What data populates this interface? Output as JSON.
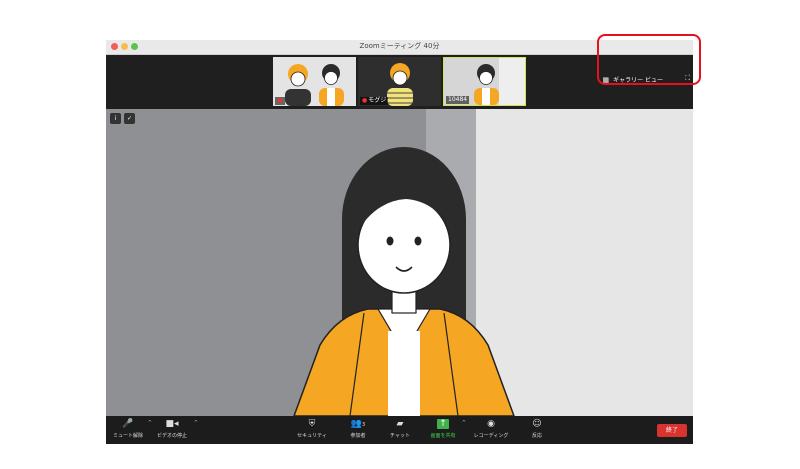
{
  "window": {
    "title": "Zoomミーティング   40分"
  },
  "thumbnails": [
    {
      "label": ""
    },
    {
      "label": "モグジ"
    },
    {
      "label": "10484"
    }
  ],
  "top_bar": {
    "gallery_view": "ギャラリー ビュー",
    "grid_icon": "grid-icon",
    "fullscreen_icon": "fullscreen-icon"
  },
  "toolbar": {
    "mute": "ミュート解除",
    "video": "ビデオの停止",
    "security": "セキュリティ",
    "participants": "参加者",
    "participants_count": "3",
    "chat": "チャット",
    "share": "画面を共有",
    "record": "レコーディング",
    "reactions": "反応",
    "end": "終了"
  },
  "colors": {
    "accent_green": "#3fd14a",
    "end_red": "#d8332f",
    "highlight_red": "#e8101c",
    "orange_shirt": "#f5a623"
  }
}
